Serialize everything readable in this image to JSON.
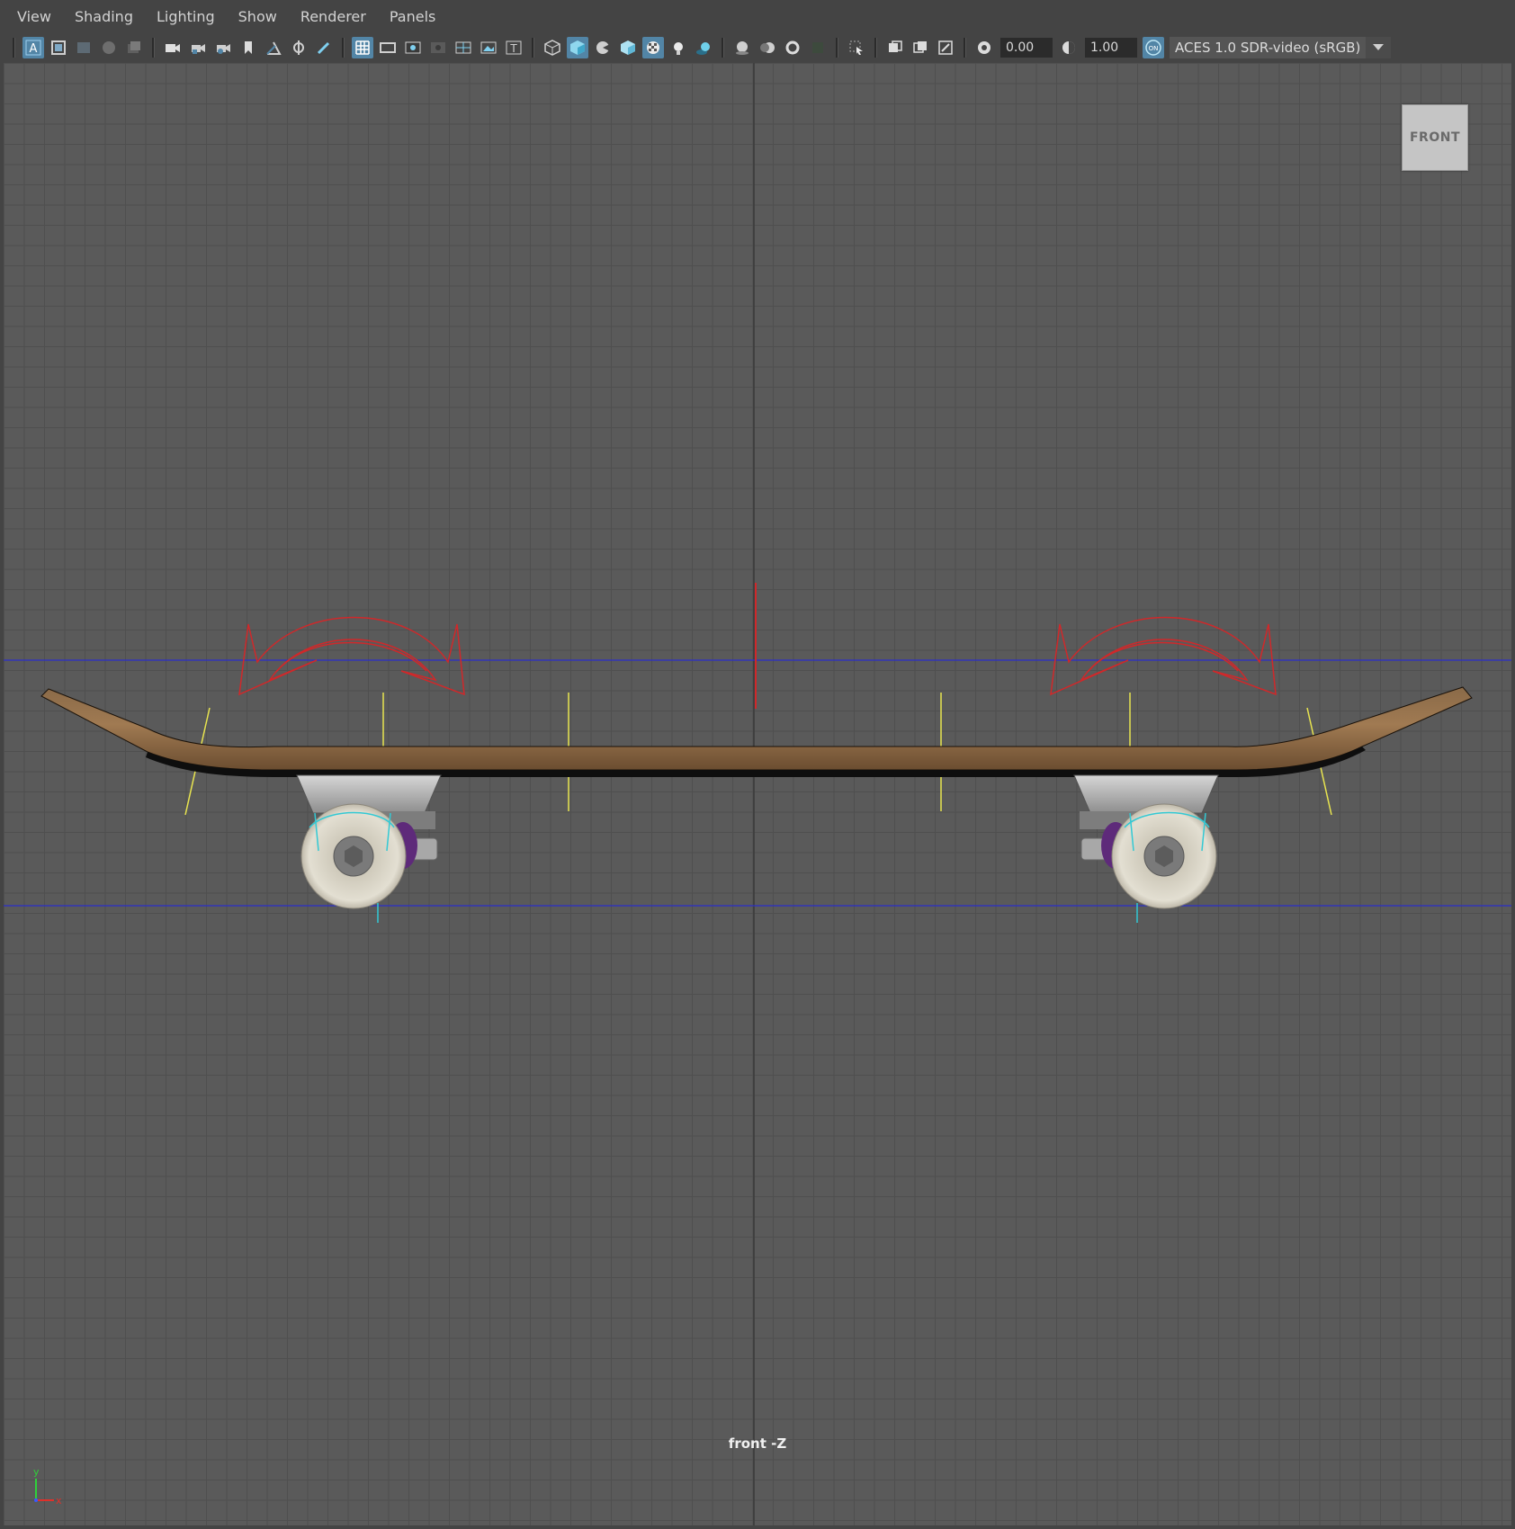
{
  "menu": [
    "View",
    "Shading",
    "Lighting",
    "Show",
    "Renderer",
    "Panels"
  ],
  "toolbar": {
    "exposure_value": "0.00",
    "gamma_value": "1.00",
    "color_management_badge": "ON",
    "color_space": "ACES 1.0 SDR-video (sRGB)"
  },
  "viewport": {
    "viewcube_label": "FRONT",
    "camera_label": "front -Z",
    "axis_y": "y",
    "axis_x": "x"
  },
  "colors": {
    "accent": "#5285a6",
    "selection_red": "#d0282a",
    "yellow_guides": "#e8e450",
    "cyan_manip": "#33c9d4",
    "horizon_blue": "#2b2dc9"
  }
}
